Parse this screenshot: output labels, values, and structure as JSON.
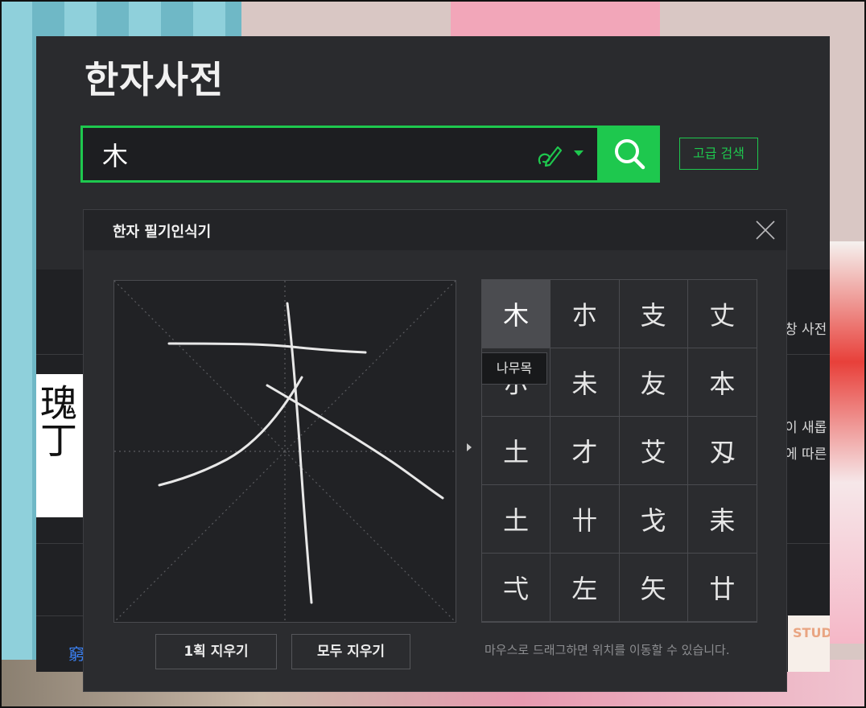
{
  "app": {
    "title": "한자사전"
  },
  "search": {
    "value": "木",
    "advanced_label": "고급 검색"
  },
  "background": {
    "side_texts": [
      "창 사전",
      "이 새롭",
      "에 따른"
    ],
    "thumb_text": "瑰丁",
    "bottom_link": "窮",
    "corner_label": "STUD"
  },
  "handwriting": {
    "title": "한자 필기인식기",
    "candidates": [
      "木",
      "朩",
      "支",
      "丈",
      "朩",
      "未",
      "友",
      "本",
      "土",
      "才",
      "艾",
      "刄",
      "土",
      "卄",
      "戈",
      "耒",
      "弌",
      "左",
      "矢",
      "廿"
    ],
    "tooltip": "나무목",
    "undo_label": "1획 지우기",
    "clear_label": "모두 지우기",
    "hint": "마우스로 드래그하면 위치를 이동할 수 있습니다."
  },
  "colors": {
    "accent": "#1ec84e",
    "panel": "#2a2b2e"
  },
  "icons": [
    "handwrite-icon",
    "dropdown-icon",
    "search-icon",
    "close-icon"
  ]
}
